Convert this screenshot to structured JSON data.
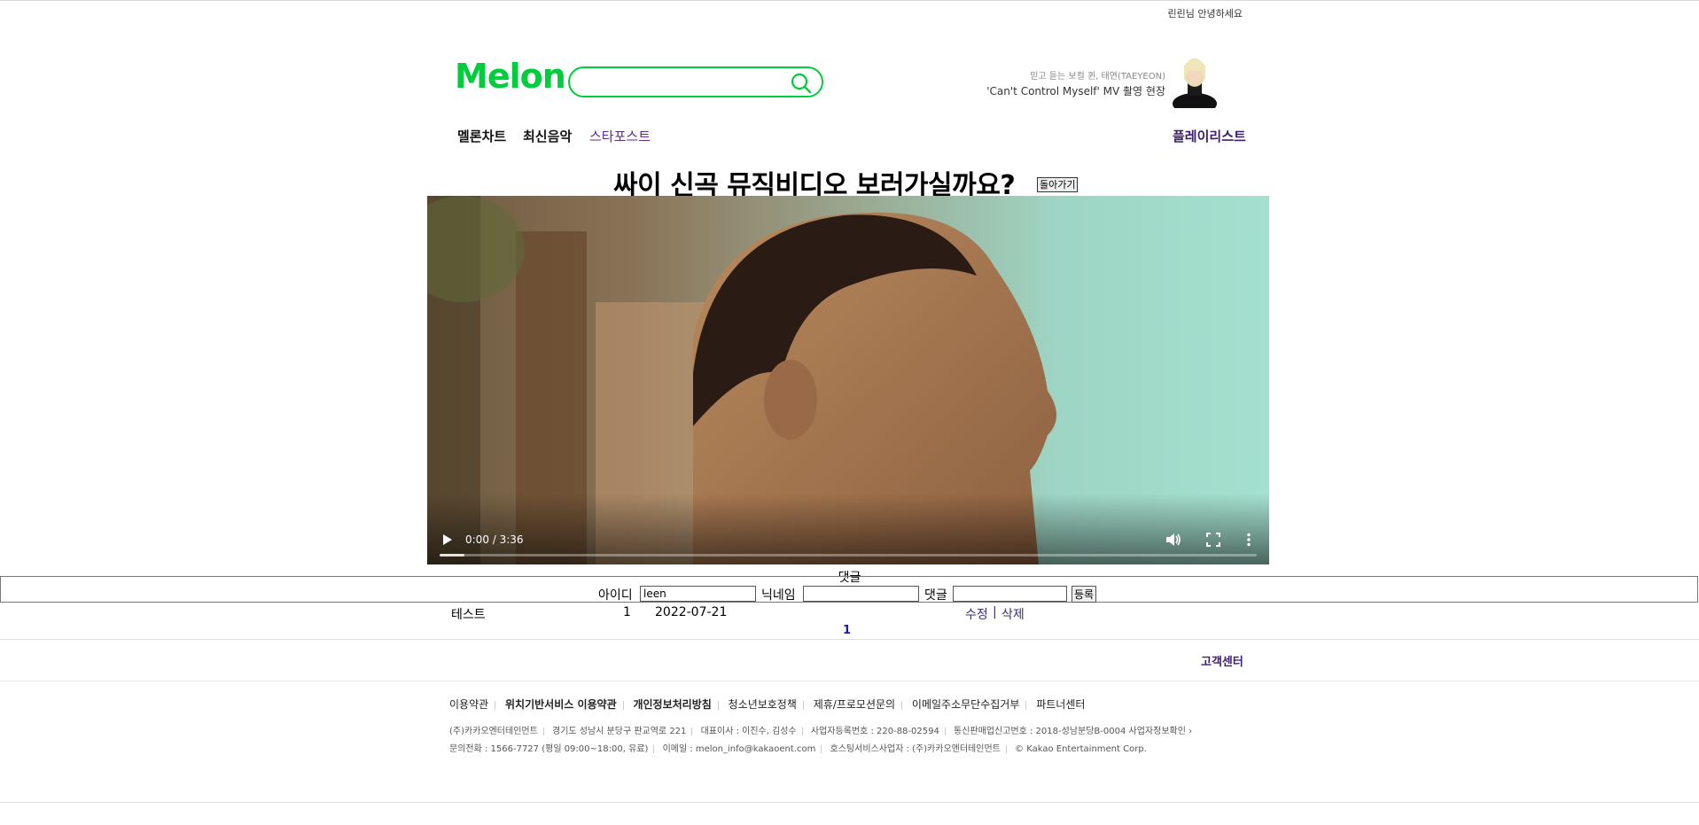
{
  "user": {
    "greeting": "린린님 안녕하세요"
  },
  "header": {
    "logo": "Melon",
    "search": {
      "placeholder": "",
      "value": ""
    },
    "banner": {
      "line1": "믿고 듣는 보컬 퀸, 태연(TAEYEON)",
      "line2": "'Can't Control Myself' MV 촬영 현장"
    }
  },
  "nav": {
    "items": [
      "멜론차트",
      "최신음악",
      "스타포스트"
    ],
    "playlist": "플레이리스트"
  },
  "page": {
    "title": "싸이 신곡 뮤직비디오 보러가실까요?",
    "back_label": "돌아가기"
  },
  "video": {
    "time": "0:00 / 3:36",
    "progress": 0.03
  },
  "comments": {
    "title": "댓글",
    "form": {
      "id_label": "아이디",
      "id_value": "leen",
      "nickname_label": "닉네임",
      "nickname_value": "",
      "comment_label": "댓글",
      "comment_value": "",
      "submit_label": "등록"
    },
    "rows": [
      {
        "text": "테스트",
        "num": "1",
        "date": "2022-07-21",
        "edit": "수정",
        "sep": "|",
        "delete": "삭제"
      }
    ],
    "page": "1"
  },
  "footer": {
    "customer_center": "고객센터",
    "links": [
      "이용약관",
      "위치기반서비스 이용약관",
      "개인정보처리방침",
      "청소년보호정책",
      "제휴/프로모션문의",
      "이메일주소무단수집거부",
      "파트너센터"
    ],
    "info1": [
      "(주)카카오엔터테인먼트",
      "경기도 성남시 분당구 판교역로 221",
      "대표이사 : 이진수, 김성수",
      "사업자등록번호 : 220-88-02594",
      "통신판매업신고번호 : 2018-성남분당B-0004",
      "사업자정보확인"
    ],
    "info2": [
      "문의전화 : 1566-7727 (평일 09:00~18:00, 유료)",
      "이메일 : melon_info@kakaoent.com",
      "호스팅서비스사업자 : (주)카카오엔터테인먼트",
      "© Kakao Entertainment Corp."
    ]
  },
  "colors": {
    "brand": "#00cd3c",
    "accent": "#5a2d87"
  }
}
